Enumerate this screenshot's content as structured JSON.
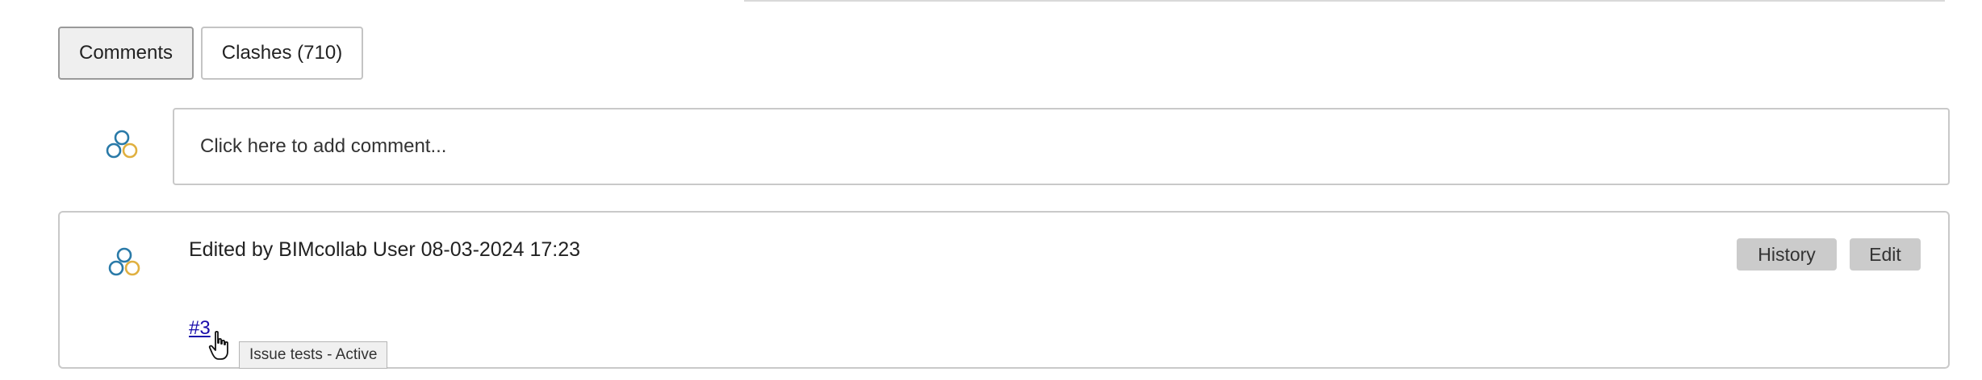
{
  "tabs": [
    {
      "label": "Comments",
      "active": true
    },
    {
      "label": "Clashes (710)",
      "active": false
    }
  ],
  "comment_input": {
    "placeholder": "Click here to add comment..."
  },
  "comment": {
    "edited_by": "Edited by BIMcollab User 08-03-2024 17:23",
    "history_label": "History",
    "edit_label": "Edit",
    "issue_link": "#3",
    "tooltip": "Issue tests - Active"
  },
  "icons": {
    "avatar": "bimcollab-logo-icon",
    "cursor": "hand-pointer-icon"
  },
  "colors": {
    "logo_blue": "#2a7aa8",
    "logo_gold": "#e0b040",
    "link": "#1a0dab",
    "button_bg": "#cbcbcb"
  }
}
